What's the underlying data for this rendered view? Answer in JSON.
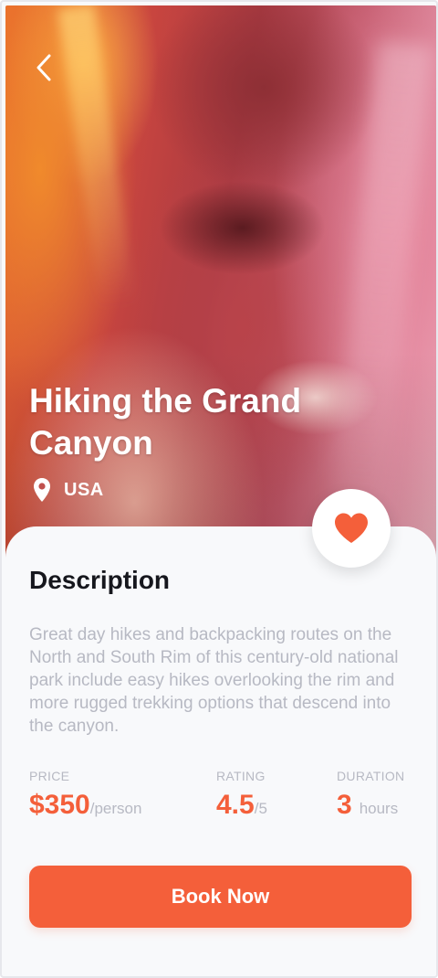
{
  "hero": {
    "title": "Hiking the Grand Canyon",
    "location": "USA"
  },
  "description": {
    "heading": "Description",
    "body": "Great day hikes and backpacking routes on the North and South Rim of this century-old national park include easy hikes overlooking the rim and more rugged trekking options that descend into the canyon."
  },
  "stats": {
    "price": {
      "label": "PRICE",
      "value": "$350",
      "unit": "/person"
    },
    "rating": {
      "label": "RATING",
      "value": "4.5",
      "unit": "/5"
    },
    "duration": {
      "label": "DURATION",
      "value": "3",
      "unit": "hours"
    }
  },
  "actions": {
    "book_label": "Book Now"
  },
  "icons": {
    "back": "chevron-left-icon",
    "location": "map-pin-icon",
    "favorite": "heart-icon"
  },
  "colors": {
    "accent": "#f45f3a",
    "heading": "#16171d",
    "muted": "#b7b9c3",
    "sheet": "#f8f9fb"
  }
}
